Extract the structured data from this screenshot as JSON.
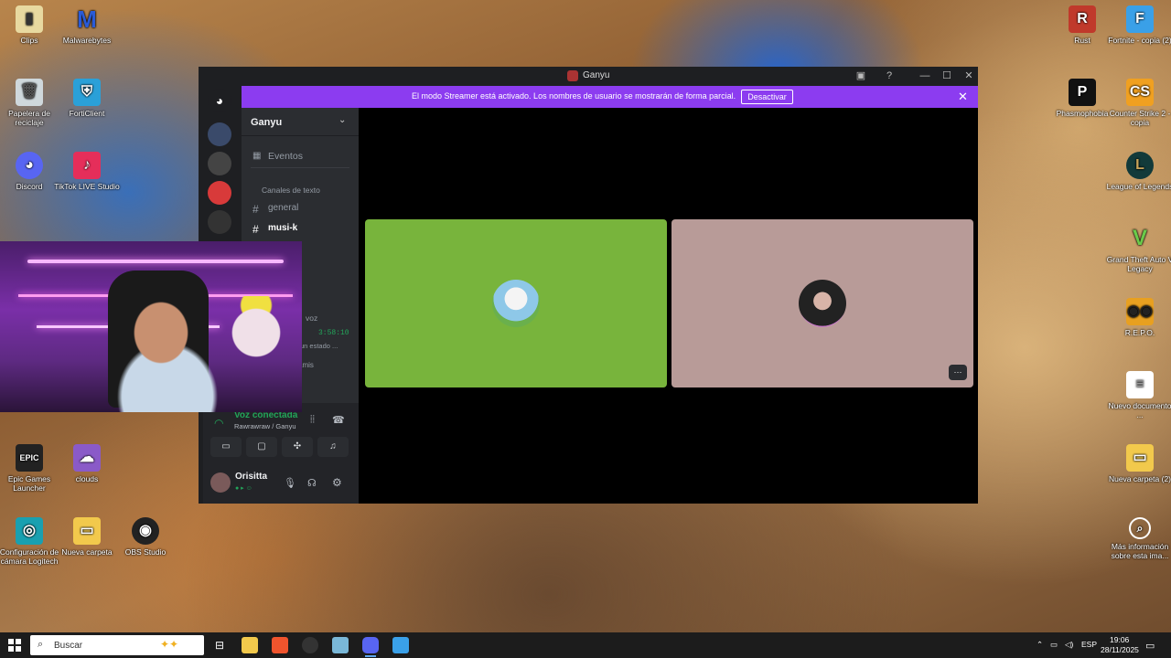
{
  "desktop": {
    "icons_left": [
      {
        "label": "Clips"
      },
      {
        "label": "Malwarebytes"
      },
      {
        "label": "Papelera de reciclaje"
      },
      {
        "label": "FortiClient"
      },
      {
        "label": "Discord"
      },
      {
        "label": "TikTok LIVE Studio"
      },
      {
        "label": "Epic Games Launcher"
      },
      {
        "label": "clouds"
      },
      {
        "label": "Configuración de cámara Logitech"
      },
      {
        "label": "Nueva carpeta"
      },
      {
        "label": "OBS Studio"
      }
    ],
    "icons_right": [
      {
        "label": "Rust"
      },
      {
        "label": "Fortnite - copia (2)"
      },
      {
        "label": "Phasmophobia"
      },
      {
        "label": "Counter Strike 2 - copia"
      },
      {
        "label": "League of Legends"
      },
      {
        "label": "Grand Theft Auto V Legacy"
      },
      {
        "label": "R.E.P.O."
      },
      {
        "label": "Nuevo documento ..."
      },
      {
        "label": "Nueva carpeta (2)"
      },
      {
        "label": "Más información sobre esta ima..."
      }
    ]
  },
  "window": {
    "title": "Ganyu",
    "banner": {
      "message": "El modo Streamer está activado. Los nombres de usuario se mostrarán de forma parcial.",
      "button": "Desactivar"
    },
    "server": {
      "name": "Ganyu",
      "events": "Eventos",
      "category": "Canales de texto",
      "channels": [
        "general",
        "musi-k"
      ],
      "voice_category": "voz",
      "voice_timer": "3:58:10",
      "status_hint": "un estado ...",
      "partial_text": "amis"
    },
    "voice": {
      "status": "Voz conectada",
      "location": "Rawrawraw / Ganyu"
    },
    "user": {
      "name": "Orisitta"
    },
    "tiles": [
      {
        "color": "#78b43c"
      },
      {
        "color": "#b89b98"
      }
    ],
    "more_button": "···"
  },
  "taskbar": {
    "search_placeholder": "Buscar",
    "language": "ESP",
    "time": "19:06",
    "date": "28/11/2025"
  }
}
